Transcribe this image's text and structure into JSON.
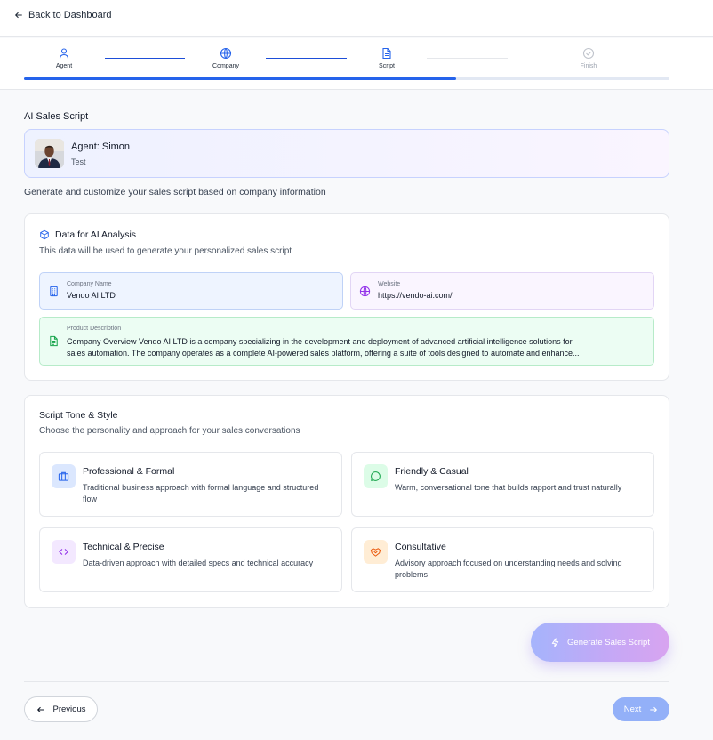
{
  "nav": {
    "back_label": "Back to Dashboard"
  },
  "stepper": {
    "steps": [
      {
        "label": "Agent",
        "icon": "user-icon",
        "state": "complete"
      },
      {
        "label": "Company",
        "icon": "globe-icon",
        "state": "complete"
      },
      {
        "label": "Script",
        "icon": "document-icon",
        "state": "active"
      },
      {
        "label": "Finish",
        "icon": "check-circle-icon",
        "state": "inactive"
      }
    ],
    "progress_fraction": 0.67
  },
  "script_section": {
    "title": "AI Sales Script"
  },
  "agent": {
    "name": "Agent: Simon",
    "subtitle": "Test"
  },
  "intro_text": "Generate and customize your sales script based on company information",
  "analysis": {
    "title": "Data for AI Analysis",
    "subtitle": "This data will be used to generate your personalized sales script",
    "company": {
      "label": "Company Name",
      "value": "Vendo AI LTD"
    },
    "website": {
      "label": "Website",
      "value": "https://vendo-ai.com/"
    },
    "product": {
      "label": "Product Description",
      "line1": "Company Overview Vendo AI LTD is a company specializing in the development and deployment of advanced artificial intelligence solutions for",
      "line2": "sales automation. The company operates as a complete AI-powered sales platform, offering a suite of tools designed to automate and enhance..."
    }
  },
  "tone": {
    "title": "Script Tone & Style",
    "subtitle": "Choose the personality and approach for your sales conversations",
    "options": [
      {
        "title": "Professional & Formal",
        "desc": "Traditional business approach with formal language and structured flow",
        "icon": "briefcase-icon",
        "color": "#2563eb",
        "bg": "#dbe7fe"
      },
      {
        "title": "Friendly & Casual",
        "desc": "Warm, conversational tone that builds rapport and trust naturally",
        "icon": "chat-bubble-icon",
        "color": "#16a34a",
        "bg": "#dcfce7"
      },
      {
        "title": "Technical & Precise",
        "desc": "Data-driven approach with detailed specs and technical accuracy",
        "icon": "code-icon",
        "color": "#9333ea",
        "bg": "#f3e8ff"
      },
      {
        "title": "Consultative",
        "desc": "Advisory approach focused on understanding needs and solving problems",
        "icon": "handshake-icon",
        "color": "#ea580c",
        "bg": "#ffedd5"
      }
    ]
  },
  "actions": {
    "generate_label": "Generate Sales Script",
    "previous_label": "Previous",
    "next_label": "Next"
  },
  "colors": {
    "primary": "#2563eb",
    "page_bg": "#f8f9fb"
  }
}
